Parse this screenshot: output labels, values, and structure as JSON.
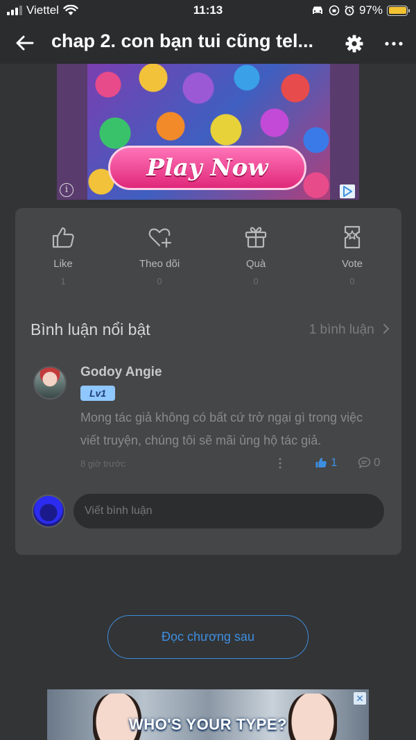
{
  "status_bar": {
    "carrier": "Viettel",
    "time": "11:13",
    "battery": "97%"
  },
  "header": {
    "title": "chap 2. con bạn tui cũng tel..."
  },
  "ad_top": {
    "cta": "Play Now"
  },
  "actions": [
    {
      "label": "Like",
      "count": "1"
    },
    {
      "label": "Theo dõi",
      "count": "0"
    },
    {
      "label": "Quà",
      "count": "0"
    },
    {
      "label": "Vote",
      "count": "0"
    }
  ],
  "comments_section": {
    "title": "Bình luận nổi bật",
    "count_link": "1 bình luận"
  },
  "comment": {
    "author": "Godoy Angie",
    "level": "Lv1",
    "text": "Mong tác giả không có bất cứ trở ngại gì trong việc viết truyện, chúng tôi sẽ mãi ủng hộ tác giả.",
    "time": "8 giờ trước",
    "likes": "1",
    "replies": "0"
  },
  "comment_input": {
    "placeholder": "Viết bình luận"
  },
  "next_chapter_label": "Đọc chương sau",
  "ad_bottom": {
    "text": "WHO'S YOUR TYPE?"
  },
  "colors": {
    "background": "#333436",
    "card": "#454648",
    "accent": "#3d8fe0",
    "battery": "#f3c230"
  }
}
